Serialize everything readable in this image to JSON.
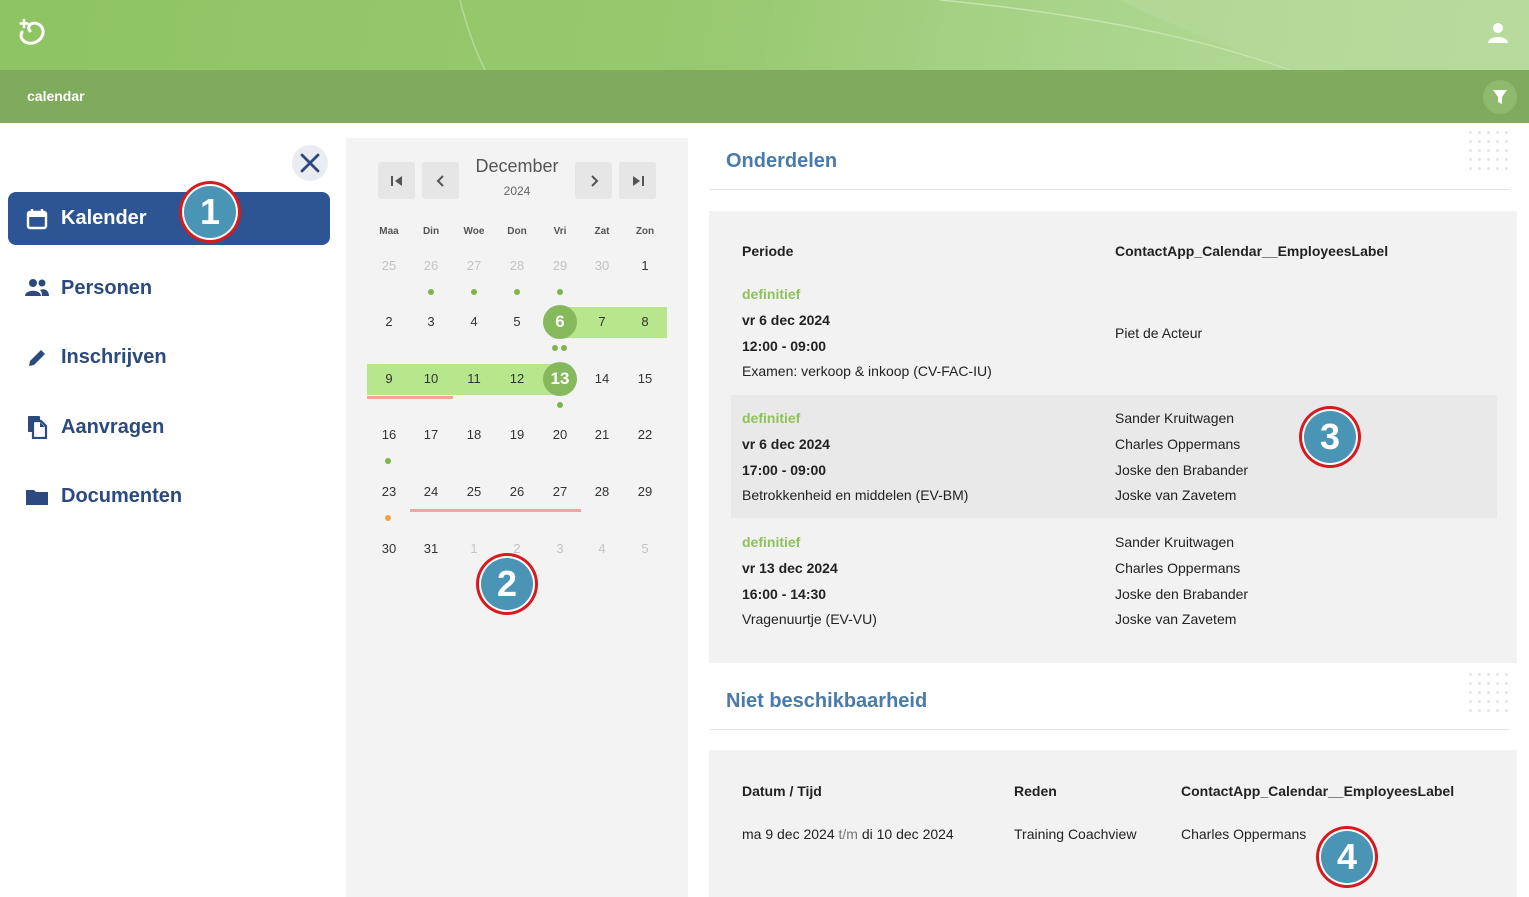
{
  "header": {
    "breadcrumb": "calendar"
  },
  "sidebar": {
    "items": [
      {
        "label": "Kalender",
        "icon": "calendar-icon",
        "active": true
      },
      {
        "label": "Personen",
        "icon": "people-icon",
        "active": false
      },
      {
        "label": "Inschrijven",
        "icon": "pencil-icon",
        "active": false
      },
      {
        "label": "Aanvragen",
        "icon": "copy-icon",
        "active": false
      },
      {
        "label": "Documenten",
        "icon": "folder-icon",
        "active": false
      }
    ]
  },
  "calendar": {
    "month": "December",
    "year": "2024",
    "weekdays": [
      "Maa",
      "Din",
      "Woe",
      "Don",
      "Vri",
      "Zat",
      "Zon"
    ],
    "weeks": [
      [
        "25",
        "26",
        "27",
        "28",
        "29",
        "30",
        "1"
      ],
      [
        "2",
        "3",
        "4",
        "5",
        "6",
        "7",
        "8"
      ],
      [
        "9",
        "10",
        "11",
        "12",
        "13",
        "14",
        "15"
      ],
      [
        "16",
        "17",
        "18",
        "19",
        "20",
        "21",
        "22"
      ],
      [
        "23",
        "24",
        "25",
        "26",
        "27",
        "28",
        "29"
      ],
      [
        "30",
        "31",
        "1",
        "2",
        "3",
        "4",
        "5"
      ]
    ],
    "selected_days": [
      "6",
      "13"
    ]
  },
  "onderdelen": {
    "title": "Onderdelen",
    "col_period": "Periode",
    "col_employees": "ContactApp_Calendar__EmployeesLabel",
    "rows": [
      {
        "status": "definitief",
        "date": "vr 6 dec 2024",
        "time": "12:00 - 09:00",
        "desc": "Examen: verkoop & inkoop (CV-FAC-IU)",
        "employees": [
          "Piet de Acteur"
        ]
      },
      {
        "status": "definitief",
        "date": "vr 6 dec 2024",
        "time": "17:00 - 09:00",
        "desc": "Betrokkenheid en middelen (EV-BM)",
        "employees": [
          "Sander Kruitwagen",
          "Charles Oppermans",
          "Joske den Brabander",
          "Joske van Zavetem"
        ]
      },
      {
        "status": "definitief",
        "date": "vr 13 dec 2024",
        "time": "16:00 - 14:30",
        "desc": "Vragenuurtje (EV-VU)",
        "employees": [
          "Sander Kruitwagen",
          "Charles Oppermans",
          "Joske den Brabander",
          "Joske van Zavetem"
        ]
      }
    ]
  },
  "niet_beschikbaarheid": {
    "title": "Niet beschikbaarheid",
    "col_date": "Datum / Tijd",
    "col_reason": "Reden",
    "col_employees": "ContactApp_Calendar__EmployeesLabel",
    "rows": [
      {
        "date_from": "ma 9 dec 2024",
        "separator": "t/m",
        "date_to": "di 10 dec 2024",
        "reason": "Training Coachview",
        "employee": "Charles Oppermans"
      }
    ]
  },
  "callouts": [
    "1",
    "2",
    "3",
    "4"
  ],
  "colors": {
    "brand_green": "#8ec463",
    "nav_active": "#2d5594",
    "status_green": "#8dc259",
    "title_blue": "#4a7aaa",
    "callout_blue": "#4a94b5",
    "callout_red": "#d8191e"
  }
}
